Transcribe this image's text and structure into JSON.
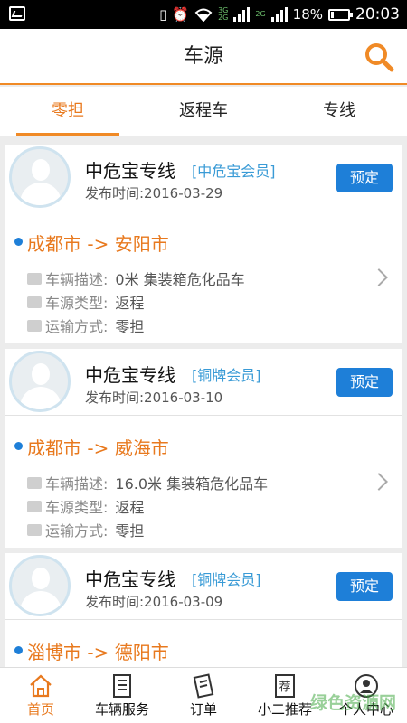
{
  "status_bar": {
    "icons": [
      "image-icon",
      "vibrate-icon",
      "alarm-icon",
      "wifi-icon",
      "signal-icon",
      "battery-icon"
    ],
    "network_top": "3G",
    "network_bottom": "2G",
    "network2_top": "2G",
    "battery": "18%",
    "time": "20:03"
  },
  "header": {
    "title": "车源",
    "search_icon": "search-icon",
    "accent": "#f08a26"
  },
  "tabs": [
    {
      "label": "零担",
      "active": true
    },
    {
      "label": "返程车",
      "active": false
    },
    {
      "label": "专线",
      "active": false
    }
  ],
  "cards": [
    {
      "name": "中危宝专线",
      "member": "[中危宝会员]",
      "date": "发布时间:2016-03-29",
      "button": "预定",
      "route": "成都市  -> 安阳市",
      "vehicle_label": "车辆描述:",
      "vehicle_value": "0米  集装箱危化品车",
      "type_label": "车源类型:",
      "type_value": "返程",
      "transport_label": "运输方式:",
      "transport_value": "零担"
    },
    {
      "name": "中危宝专线",
      "member": "[铜牌会员]",
      "date": "发布时间:2016-03-10",
      "button": "预定",
      "route": "成都市  -> 威海市",
      "vehicle_label": "车辆描述:",
      "vehicle_value": "16.0米  集装箱危化品车",
      "type_label": "车源类型:",
      "type_value": "返程",
      "transport_label": "运输方式:",
      "transport_value": "零担"
    },
    {
      "name": "中危宝专线",
      "member": "[铜牌会员]",
      "date": "发布时间:2016-03-09",
      "button": "预定",
      "route": "淄博市  -> 德阳市"
    }
  ],
  "bottom_nav": [
    {
      "label": "首页",
      "icon": "home-icon",
      "active": true
    },
    {
      "label": "车辆服务",
      "icon": "document-icon",
      "active": false
    },
    {
      "label": "订单",
      "icon": "order-icon",
      "active": false
    },
    {
      "label": "小二推荐",
      "icon": "recommend-icon",
      "active": false
    },
    {
      "label": "个人中心",
      "icon": "profile-icon",
      "active": false
    }
  ],
  "watermark": "绿色资源网"
}
